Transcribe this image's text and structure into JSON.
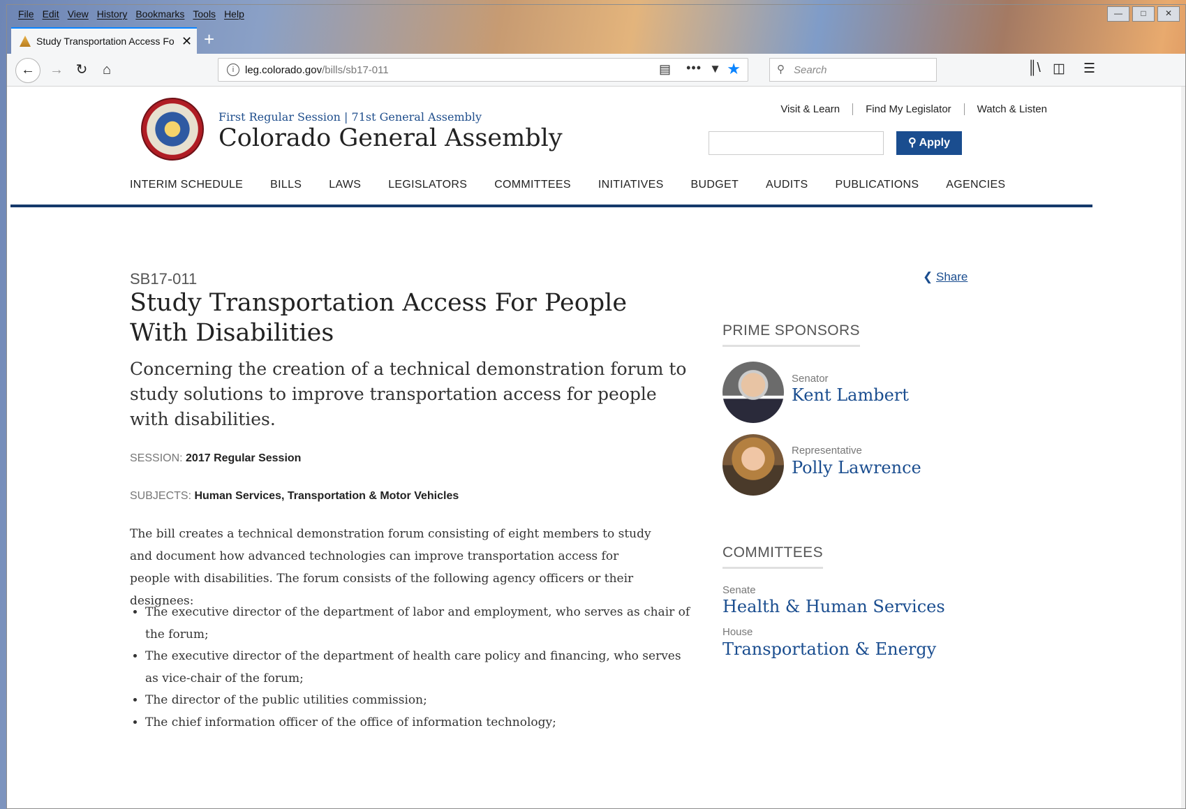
{
  "browser": {
    "menu": [
      "File",
      "Edit",
      "View",
      "History",
      "Bookmarks",
      "Tools",
      "Help"
    ],
    "tab_title": "Study Transportation Access Fo",
    "url_domain": "leg.colorado.gov",
    "url_path": "/bills/sb17-011",
    "search_placeholder": "Search"
  },
  "site": {
    "subtitle": "First Regular Session | 71st General Assembly",
    "title": "Colorado General Assembly",
    "top_links": [
      "Visit & Learn",
      "Find My Legislator",
      "Watch & Listen"
    ],
    "apply_label": "Apply",
    "nav": [
      "INTERIM SCHEDULE",
      "BILLS",
      "LAWS",
      "LEGISLATORS",
      "COMMITTEES",
      "INITIATIVES",
      "BUDGET",
      "AUDITS",
      "PUBLICATIONS",
      "AGENCIES"
    ]
  },
  "bill": {
    "number": "SB17-011",
    "title": "Study Transportation Access For People With Disabilities",
    "summary": "Concerning the creation of a technical demonstration forum to study solutions to improve transportation access for people with disabilities.",
    "session_label": "SESSION:",
    "session_value": "2017 Regular Session",
    "subjects_label": "SUBJECTS:",
    "subjects_value": "Human Services,  Transportation & Motor Vehicles",
    "body": "The bill creates a technical demonstration forum consisting of eight members to study and document how advanced technologies can improve transportation access for people with disabilities. The forum consists of the following agency officers or their designees:",
    "bullets": [
      "The executive director of the department of labor and employment, who serves as chair of the forum;",
      "The executive director of the department of health care policy and financing, who serves as vice-chair of the forum;",
      "The director of the public utilities commission;",
      "The chief information officer of the office of information technology;"
    ]
  },
  "sidebar": {
    "share_label": "Share",
    "sponsors_heading": "PRIME SPONSORS",
    "sponsors": [
      {
        "role": "Senator",
        "name": "Kent Lambert"
      },
      {
        "role": "Representative",
        "name": "Polly Lawrence"
      }
    ],
    "committees_heading": "COMMITTEES",
    "committees": [
      {
        "chamber": "Senate",
        "name": "Health & Human Services"
      },
      {
        "chamber": "House",
        "name": "Transportation & Energy"
      }
    ]
  }
}
